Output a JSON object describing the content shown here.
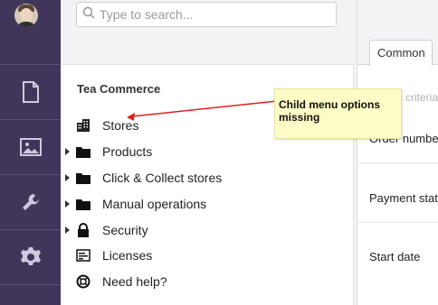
{
  "search": {
    "placeholder": "Type to search..."
  },
  "nav": {
    "items": [
      {
        "icon": "document-icon",
        "label": ""
      },
      {
        "icon": "image-icon",
        "label": ""
      },
      {
        "icon": "wrench-icon",
        "label": ""
      },
      {
        "icon": "gear-icon",
        "label": ""
      }
    ]
  },
  "tree": {
    "title": "Tea Commerce",
    "nodes": [
      {
        "label": "Stores",
        "icon": "building-icon",
        "expandable": false
      },
      {
        "label": "Products",
        "icon": "folder-icon",
        "expandable": true
      },
      {
        "label": "Click & Collect stores",
        "icon": "folder-icon",
        "expandable": true
      },
      {
        "label": "Manual operations",
        "icon": "folder-icon",
        "expandable": true
      },
      {
        "label": "Security",
        "icon": "lock-icon",
        "expandable": true
      },
      {
        "label": "Licenses",
        "icon": "license-icon",
        "expandable": false
      },
      {
        "label": "Need help?",
        "icon": "help-icon",
        "expandable": false
      }
    ]
  },
  "editor": {
    "tab": "Common",
    "hint": "criteria",
    "fields": [
      "Order numbe",
      "Payment stat",
      "Start date"
    ]
  },
  "annotation": {
    "text_line1": "Child menu options",
    "text_line2": "missing",
    "color": "#e02020"
  }
}
